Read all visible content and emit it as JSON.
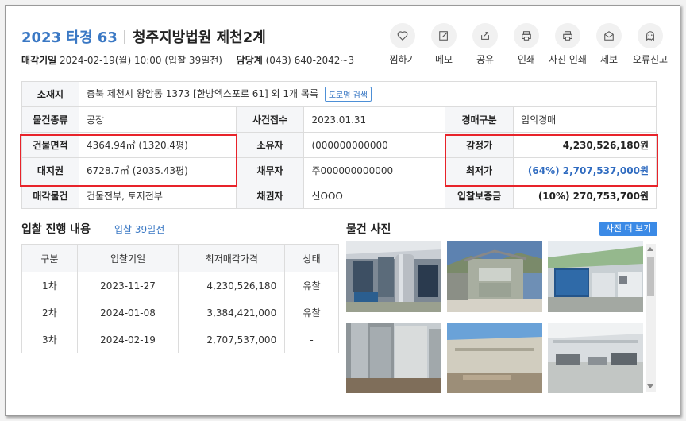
{
  "header": {
    "case_no": "2023 타경 63",
    "court": "청주지방법원 제천2계",
    "sale_date_label": "매각기일",
    "sale_date_value": "2024-02-19(월) 10:00 (입찰 39일전)",
    "dept_label": "담당계",
    "dept_value": "(043) 640-2042~3"
  },
  "actions": [
    {
      "label": "찜하기",
      "icon": "heart-icon"
    },
    {
      "label": "메모",
      "icon": "pencil-icon"
    },
    {
      "label": "공유",
      "icon": "share-icon"
    },
    {
      "label": "인쇄",
      "icon": "printer-icon"
    },
    {
      "label": "사진 인쇄",
      "icon": "printer-icon"
    },
    {
      "label": "제보",
      "icon": "envelope-icon"
    },
    {
      "label": "오류신고",
      "icon": "ghost-icon"
    }
  ],
  "info": {
    "location_label": "소재지",
    "location_value": "충북 제천시 왕암동 1373 [한방엑스포로 61] 외 1개 목록",
    "road_search": "도로명 검색",
    "type_label": "물건종류",
    "type_value": "공장",
    "filed_label": "사건접수",
    "filed_value": "2023.01.31",
    "auction_kind_label": "경매구분",
    "auction_kind_value": "임의경매",
    "bldg_area_label": "건물면적",
    "bldg_area_value": "4364.94㎡ (1320.4평)",
    "owner_label": "소유자",
    "owner_value": "(000000000000",
    "appraisal_label": "감정가",
    "appraisal_value": "4,230,526,180원",
    "land_label": "대지권",
    "land_value": "6728.7㎡ (2035.43평)",
    "debtor_label": "채무자",
    "debtor_value": "주000000000000",
    "min_price_label": "최저가",
    "min_price_value": "(64%) 2,707,537,000원",
    "sale_item_label": "매각물건",
    "sale_item_value": "건물전부, 토지전부",
    "creditor_label": "채권자",
    "creditor_value": "신OOO",
    "deposit_label": "입찰보증금",
    "deposit_value": "(10%) 270,753,700원"
  },
  "bids": {
    "title": "입찰 진행 내용",
    "subtitle": "입찰 39일전",
    "columns": [
      "구분",
      "입찰기일",
      "최저매각가격",
      "상태"
    ],
    "rows": [
      [
        "1차",
        "2023-11-27",
        "4,230,526,180",
        "유찰"
      ],
      [
        "2차",
        "2024-01-08",
        "3,384,421,000",
        "유찰"
      ],
      [
        "3차",
        "2024-02-19",
        "2,707,537,000",
        "-"
      ]
    ]
  },
  "photos": {
    "title": "물건 사진",
    "more_button": "사진 더 보기",
    "items": [
      "factory-interior-photo",
      "building-exterior-photo",
      "hvac-units-photo",
      "silo-exterior-photo",
      "warehouse-wall-photo",
      "empty-hall-photo"
    ]
  },
  "colors": {
    "accent": "#3a78c4",
    "highlight": "#e8232a",
    "button": "#3b8ae6"
  }
}
